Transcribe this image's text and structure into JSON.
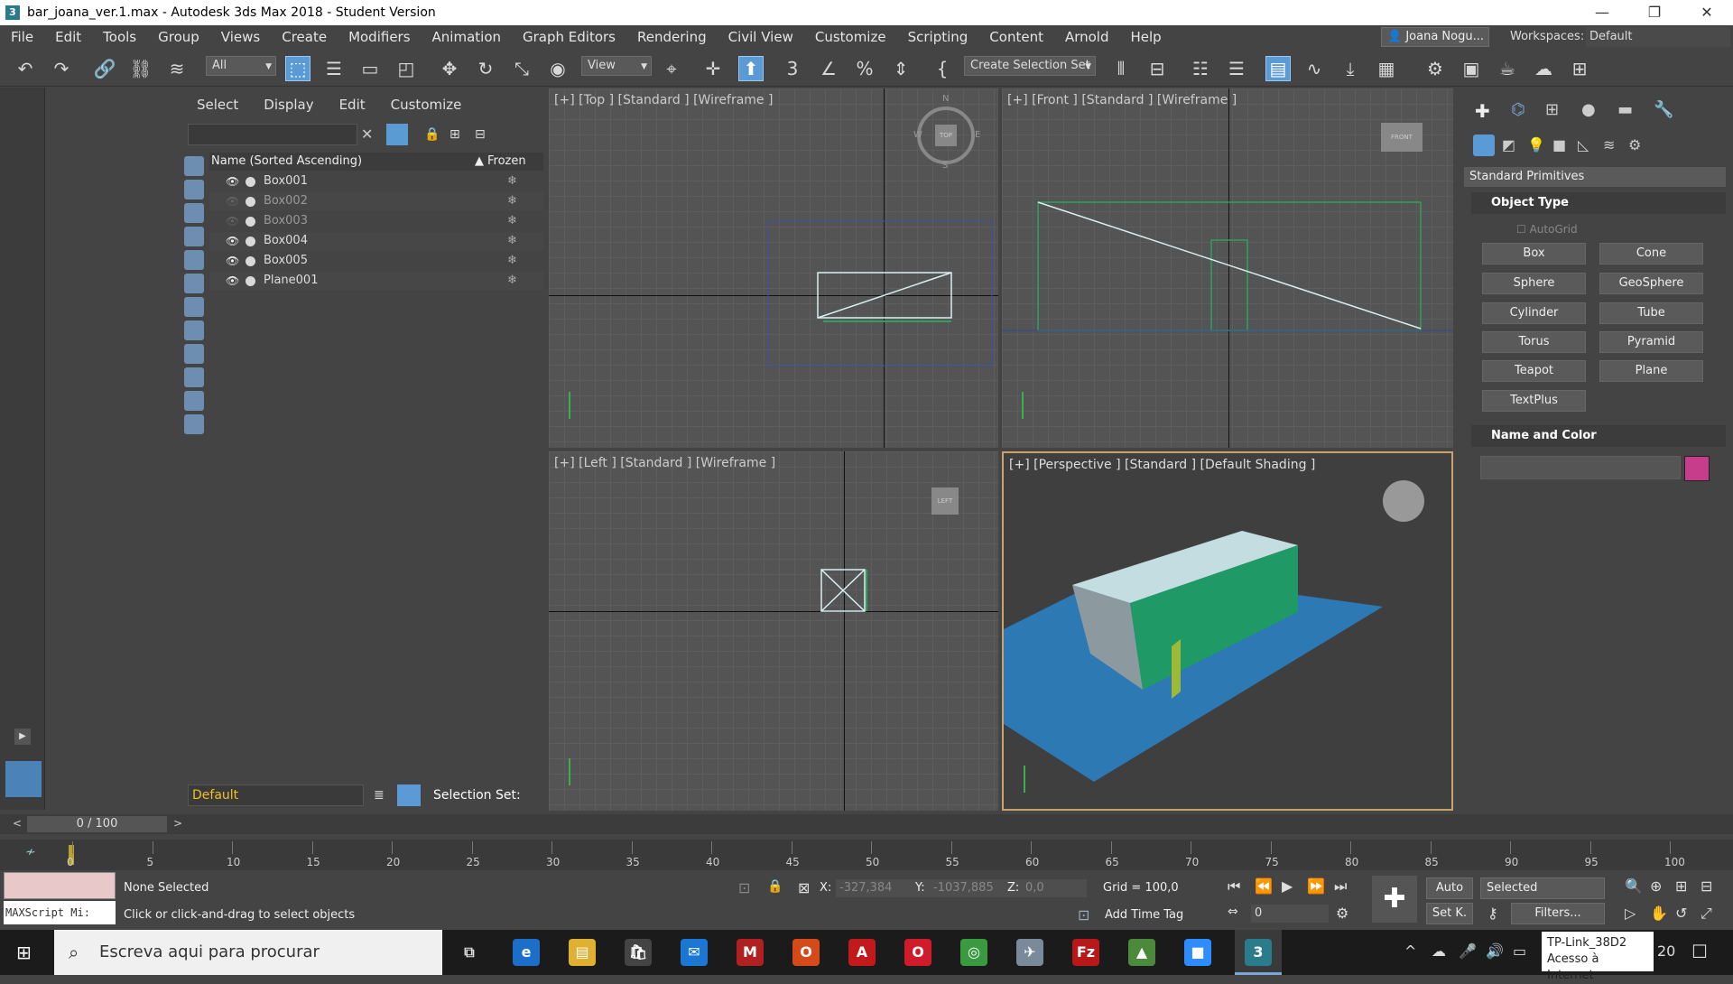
{
  "titlebar": {
    "title": "bar_joana_ver.1.max - Autodesk 3ds Max 2018 - Student Version",
    "app_icon": "3",
    "win_min": "—",
    "win_max": "❐",
    "win_close": "✕"
  },
  "menu": {
    "items": [
      "File",
      "Edit",
      "Tools",
      "Group",
      "Views",
      "Create",
      "Modifiers",
      "Animation",
      "Graph Editors",
      "Rendering",
      "Civil View",
      "Customize",
      "Scripting",
      "Content",
      "Arnold",
      "Help"
    ]
  },
  "user": {
    "name": "Joana Nogu..."
  },
  "workspace": {
    "label": "Workspaces:",
    "value": "Default"
  },
  "toolbar": {
    "filter_value": "All",
    "view_value": "View",
    "selection_set_value": "Create Selection Set"
  },
  "scene_explorer": {
    "tabs": [
      "Select",
      "Display",
      "Edit",
      "Customize"
    ],
    "column_name": "Name (Sorted Ascending)",
    "column_frozen": "Frozen",
    "rows": [
      {
        "name": "Box001",
        "visible": true
      },
      {
        "name": "Box002",
        "visible": false
      },
      {
        "name": "Box003",
        "visible": false
      },
      {
        "name": "Box004",
        "visible": true
      },
      {
        "name": "Box005",
        "visible": true
      },
      {
        "name": "Plane001",
        "visible": true
      }
    ],
    "layer_value": "Default",
    "selection_set_label": "Selection Set:"
  },
  "viewports": {
    "top": "[+] [Top ] [Standard ] [Wireframe ]",
    "front": "[+] [Front ] [Standard ] [Wireframe ]",
    "left": "[+] [Left ] [Standard ] [Wireframe ]",
    "perspective": "[+] [Perspective ] [Standard ] [Default Shading ]",
    "compass": {
      "n": "N",
      "s": "S",
      "e": "E",
      "w": "W",
      "cube": "TOP"
    }
  },
  "command_panel": {
    "dropdown": "Standard Primitives",
    "object_type_title": "Object Type",
    "autogrid": "AutoGrid",
    "buttons": [
      "Box",
      "Cone",
      "Sphere",
      "GeoSphere",
      "Cylinder",
      "Tube",
      "Torus",
      "Pyramid",
      "Teapot",
      "Plane",
      "TextPlus"
    ],
    "name_color_title": "Name and Color",
    "object_color": "#c83c8c"
  },
  "timeline": {
    "slider_label": "0 / 100",
    "ticks": [
      "0",
      "5",
      "10",
      "15",
      "20",
      "25",
      "30",
      "35",
      "40",
      "45",
      "50",
      "55",
      "60",
      "65",
      "70",
      "75",
      "80",
      "85",
      "90",
      "95",
      "100"
    ]
  },
  "status": {
    "maxscript": "MAXScript Mi:",
    "selection": "None Selected",
    "prompt": "Click or click-and-drag to select objects",
    "x_label": "X:",
    "x_value": "-327,384",
    "y_label": "Y:",
    "y_value": "-1037,885",
    "z_label": "Z:",
    "z_value": "0,0",
    "grid": "Grid = 100,0",
    "add_time_tag": "Add Time Tag",
    "auto": "Auto",
    "set_key": "Set K.",
    "key_mode": "Selected",
    "filters": "Filters...",
    "frame_value": "0"
  },
  "taskbar": {
    "search_placeholder": "Escreva aqui para procurar",
    "network_tooltip_line1": "TP-Link_38D2",
    "network_tooltip_line2": "Acesso à Internet",
    "clock_fragment": "20"
  }
}
